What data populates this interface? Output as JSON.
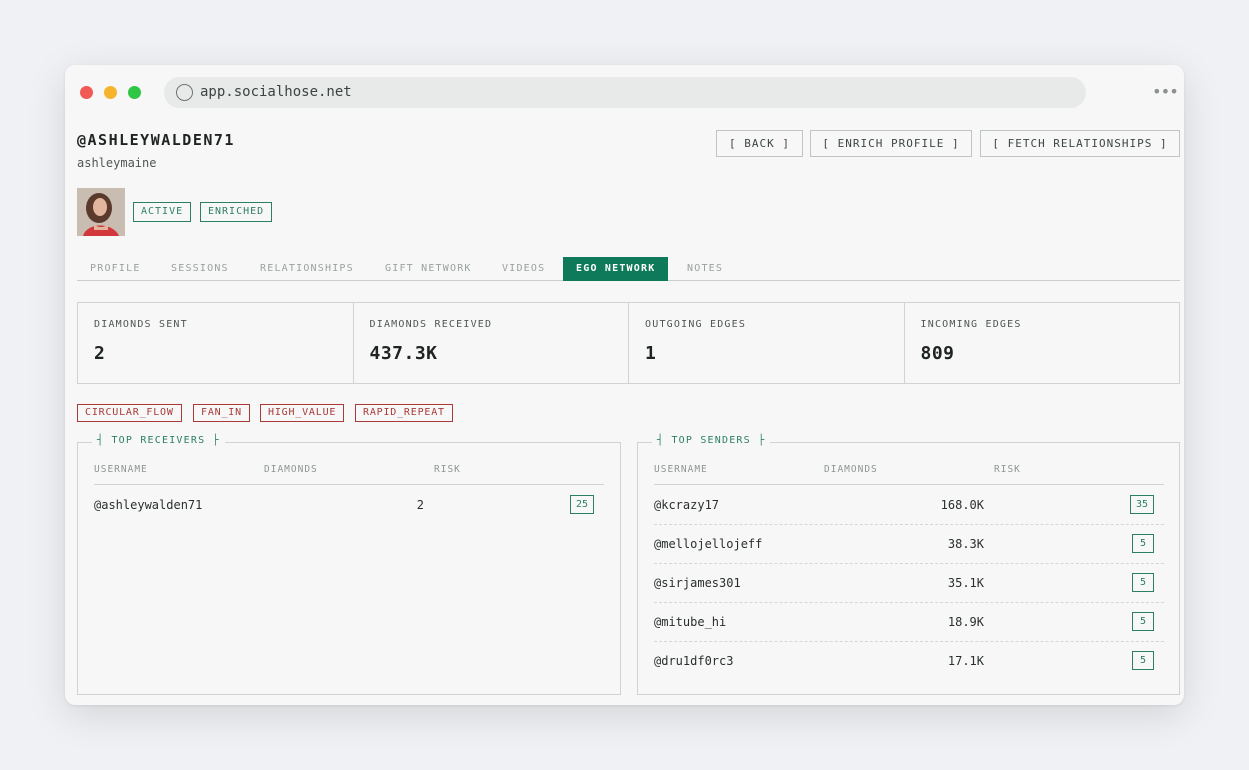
{
  "browser": {
    "url": "app.socialhose.net",
    "more_label": "•••"
  },
  "profile": {
    "username": "@ASHLEYWALDEN71",
    "handle": "ashleymaine",
    "badges": [
      "ACTIVE",
      "ENRICHED"
    ]
  },
  "actions": {
    "back": "[ BACK ]",
    "enrich": "[ ENRICH PROFILE ]",
    "fetch": "[ FETCH RELATIONSHIPS ]"
  },
  "tabs": [
    {
      "label": "PROFILE",
      "active": false
    },
    {
      "label": "SESSIONS",
      "active": false
    },
    {
      "label": "RELATIONSHIPS",
      "active": false
    },
    {
      "label": "GIFT NETWORK",
      "active": false
    },
    {
      "label": "VIDEOS",
      "active": false
    },
    {
      "label": "EGO NETWORK",
      "active": true
    },
    {
      "label": "NOTES",
      "active": false
    }
  ],
  "stats": [
    {
      "label": "DIAMONDS SENT",
      "value": "2"
    },
    {
      "label": "DIAMONDS RECEIVED",
      "value": "437.3K"
    },
    {
      "label": "OUTGOING EDGES",
      "value": "1"
    },
    {
      "label": "INCOMING EDGES",
      "value": "809"
    }
  ],
  "flags": [
    "CIRCULAR_FLOW",
    "FAN_IN",
    "HIGH_VALUE",
    "RAPID_REPEAT"
  ],
  "top_receivers": {
    "title": "┤ TOP RECEIVERS ├",
    "columns": [
      "USERNAME",
      "DIAMONDS",
      "RISK"
    ],
    "rows": [
      {
        "username": "@ashleywalden71",
        "diamonds": "2",
        "risk": "25"
      }
    ]
  },
  "top_senders": {
    "title": "┤ TOP SENDERS ├",
    "columns": [
      "USERNAME",
      "DIAMONDS",
      "RISK"
    ],
    "rows": [
      {
        "username": "@kcrazy17",
        "diamonds": "168.0K",
        "risk": "35"
      },
      {
        "username": "@mellojellojeff",
        "diamonds": "38.3K",
        "risk": "5"
      },
      {
        "username": "@sirjames301",
        "diamonds": "35.1K",
        "risk": "5"
      },
      {
        "username": "@mitube_hi",
        "diamonds": "18.9K",
        "risk": "5"
      },
      {
        "username": "@dru1df0rc3",
        "diamonds": "17.1K",
        "risk": "5"
      }
    ]
  },
  "colors": {
    "accent": "#0f7a5a",
    "flag": "#a83a3a"
  }
}
